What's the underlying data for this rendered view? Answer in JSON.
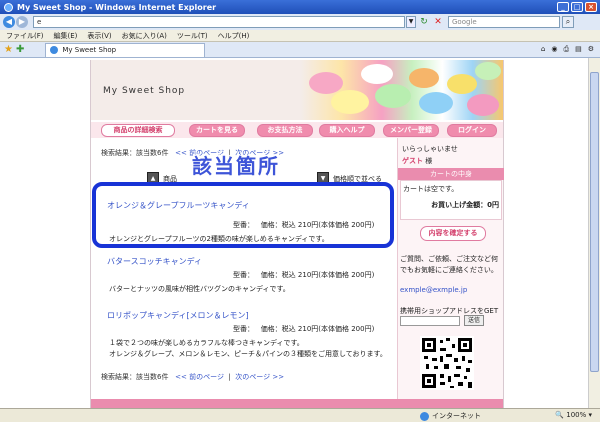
{
  "window": {
    "title": "My Sweet Shop - Windows Internet Explorer",
    "search_placeholder": "Google",
    "url": "e"
  },
  "menu": [
    "ファイル(F)",
    "編集(E)",
    "表示(V)",
    "お気に入り(A)",
    "ツール(T)",
    "ヘルプ(H)"
  ],
  "tab": {
    "label": "My Sweet Shop"
  },
  "site": {
    "logo": "My Sweet Shop",
    "nav": [
      {
        "label": "商品の詳細検索",
        "active": true
      },
      {
        "label": "カートを見る"
      },
      {
        "label": "お支払方法"
      },
      {
        "label": "購入ヘルプ"
      },
      {
        "label": "メンバー登録"
      },
      {
        "label": "ログイン"
      }
    ],
    "pager": {
      "result": "検索結果：該当数6件",
      "prev": "<< 前のページ",
      "sep": "|",
      "next": "次のページ >>"
    },
    "sort": {
      "left": "商品",
      "right": "価格順で並べる"
    },
    "callout": "該当箇所",
    "products": [
      {
        "name": "オレンジ＆グレープフルーツキャンディ",
        "model": "型番：",
        "price": "価格：税込 210円(本体価格 200円)",
        "desc": [
          "オレンジとグレープフルーツの2種類の味が楽しめるキャンディです。"
        ]
      },
      {
        "name": "バタースコッチキャンディ",
        "model": "型番：",
        "price": "価格：税込 210円(本体価格 200円)",
        "desc": [
          "バターとナッツの風味が相性バツグンのキャンディです。"
        ]
      },
      {
        "name": "ロリポップキャンディ[メロン＆レモン]",
        "model": "型番：",
        "price": "価格：税込 210円(本体価格 200円)",
        "desc": [
          "１袋で２つの味が楽しめるカラフルな棒つきキャンディです。",
          "オレンジ＆グレープ、メロン＆レモン、ピーチ＆パインの３種類をご用意しております。"
        ]
      }
    ]
  },
  "sidebar": {
    "greeting": "いらっしゃいませ",
    "guest_name": "ゲスト",
    "guest_suffix": " 様",
    "cart_title": "カートの中身",
    "cart_empty": "カートは空です。",
    "cart_total": "お買い上げ金額：0円",
    "confirm": "内容を確定する",
    "note": [
      "ご質問、ご依頼、ご注文など何",
      "でもお気軽にご連絡ください。"
    ],
    "email": "exmple@exmple.jp",
    "mobile_label": "携帯用ショップアドレスをGET",
    "send": "送信"
  },
  "status": {
    "zone": "インターネット",
    "zoom": "100%"
  }
}
